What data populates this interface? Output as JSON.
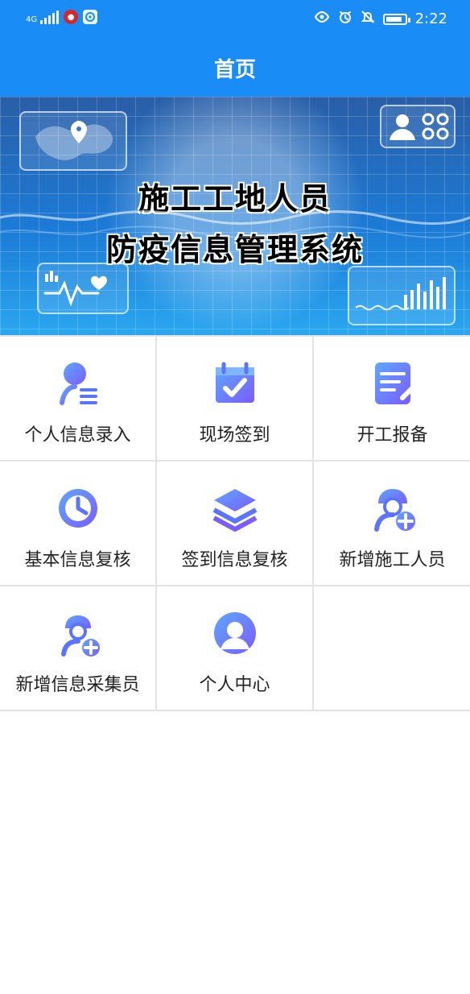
{
  "status_bar": {
    "network": "4G",
    "time": "2:22",
    "left_icons": [
      "signal-icon",
      "news-app-icon",
      "browser-app-icon"
    ],
    "right_icons": [
      "eye-icon",
      "alarm-icon",
      "mute-icon",
      "battery-icon"
    ]
  },
  "header": {
    "title": "首页"
  },
  "banner": {
    "line1": "施工工地人员",
    "line2": "防疫信息管理系统"
  },
  "menu": {
    "items": [
      {
        "label": "个人信息录入",
        "icon": "user-list-icon"
      },
      {
        "label": "现场签到",
        "icon": "calendar-check-icon"
      },
      {
        "label": "开工报备",
        "icon": "edit-document-icon"
      },
      {
        "label": "基本信息复核",
        "icon": "clock-icon"
      },
      {
        "label": "签到信息复核",
        "icon": "layers-icon"
      },
      {
        "label": "新增施工人员",
        "icon": "worker-add-icon"
      },
      {
        "label": "新增信息采集员",
        "icon": "collector-add-icon"
      },
      {
        "label": "个人中心",
        "icon": "profile-circle-icon"
      }
    ]
  },
  "colors": {
    "header_blue": "#1a8cf6",
    "icon_gradient_start": "#5ea7ff",
    "icon_gradient_end": "#7a5cff",
    "divider": "#e3e3e3"
  }
}
